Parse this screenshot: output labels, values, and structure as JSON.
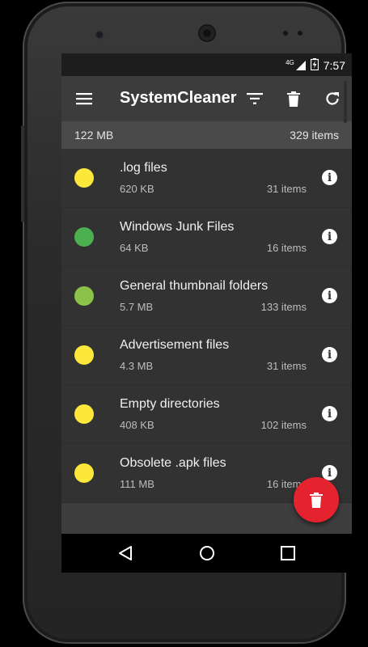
{
  "status_bar": {
    "network": "4G",
    "time": "7:57"
  },
  "toolbar": {
    "title": "SystemCleaner",
    "icons": [
      "menu-icon",
      "filter-icon",
      "trash-icon",
      "refresh-icon"
    ]
  },
  "summary": {
    "total_size": "122 MB",
    "total_items": "329 items"
  },
  "items": [
    {
      "name": ".log files",
      "size": "620 KB",
      "count": "31 items",
      "color": "#fbe83b"
    },
    {
      "name": "Windows Junk Files",
      "size": "64 KB",
      "count": "16 items",
      "color": "#4caf50"
    },
    {
      "name": "General thumbnail folders",
      "size": "5.7 MB",
      "count": "133 items",
      "color": "#8bc34a"
    },
    {
      "name": "Advertisement files",
      "size": "4.3 MB",
      "count": "31 items",
      "color": "#fbe83b"
    },
    {
      "name": "Empty directories",
      "size": "408 KB",
      "count": "102 items",
      "color": "#fbe83b"
    },
    {
      "name": "Obsolete .apk files",
      "size": "111 MB",
      "count": "16 items",
      "color": "#fbe83b"
    }
  ],
  "fab": {
    "icon": "trash-icon",
    "color": "#e5232f"
  },
  "nav": {
    "icons": [
      "back-icon",
      "home-icon",
      "recents-icon"
    ]
  }
}
